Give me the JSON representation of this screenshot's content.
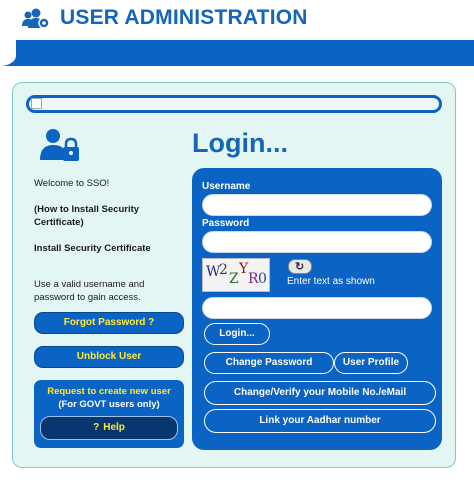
{
  "header": {
    "title": "USER ADMINISTRATION",
    "icon": "users-gear-icon"
  },
  "left": {
    "welcome": "Welcome to SSO!",
    "install_cert_howto": "(How to Install Security Certificate)",
    "install_cert": "Install Security Certificate",
    "instruction": "Use a valid username and password to gain access.",
    "forgot_password": "Forgot Password ?",
    "unblock_user": "Unblock User",
    "request_title": "Request to create new user",
    "request_sub": "(For GOVT users only)",
    "help_label": "Help"
  },
  "login": {
    "title": "Login...",
    "username_label": "Username",
    "username_value": "",
    "password_label": "Password",
    "password_value": "",
    "captcha_text": "W2ZYR0",
    "captcha_hint": "Enter text as shown",
    "captcha_value": "",
    "login_button": "Login...",
    "change_password": "Change Password",
    "user_profile": "User Profile",
    "change_verify": "Change/Verify your Mobile No./eMail",
    "link_aadhar": "Link your Aadhar number"
  },
  "colors": {
    "primary": "#0b63c4",
    "accent_text": "#ffea3a",
    "panel_bg": "#e4f6f4",
    "title": "#1566b8"
  }
}
